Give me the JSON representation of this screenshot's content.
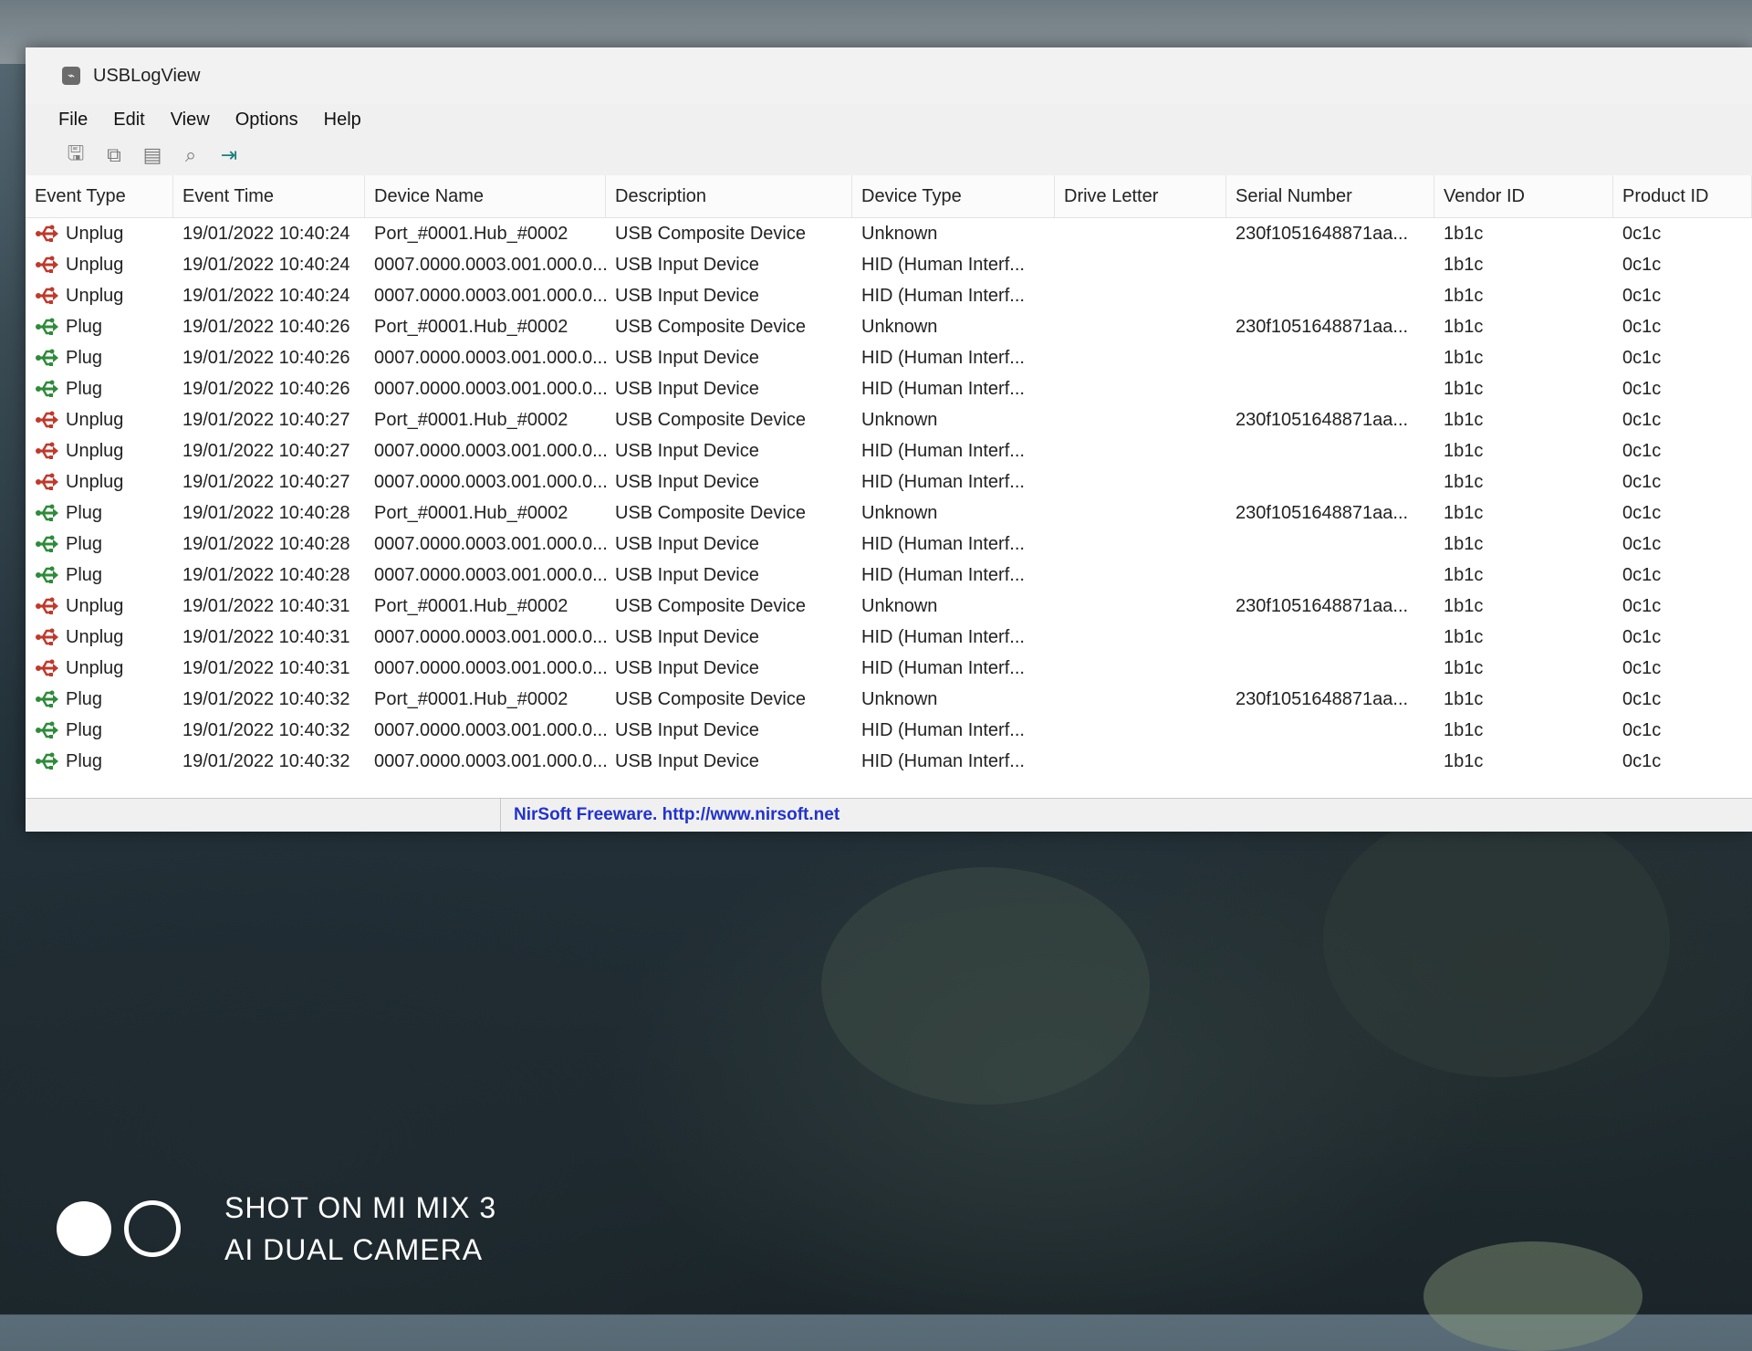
{
  "window": {
    "title": "USBLogView"
  },
  "menu": [
    "File",
    "Edit",
    "View",
    "Options",
    "Help"
  ],
  "columns": [
    "Event Type",
    "Event Time",
    "Device Name",
    "Description",
    "Device Type",
    "Drive Letter",
    "Serial Number",
    "Vendor ID",
    "Product ID"
  ],
  "rows": [
    {
      "event": "Unplug",
      "time": "19/01/2022 10:40:24",
      "device": "Port_#0001.Hub_#0002",
      "description": "USB Composite Device",
      "type": "Unknown",
      "drive": "",
      "serial": "230f1051648871aa...",
      "vendor": "1b1c",
      "product": "0c1c"
    },
    {
      "event": "Unplug",
      "time": "19/01/2022 10:40:24",
      "device": "0007.0000.0003.001.000.0...",
      "description": "USB Input Device",
      "type": "HID (Human Interf...",
      "drive": "",
      "serial": "",
      "vendor": "1b1c",
      "product": "0c1c"
    },
    {
      "event": "Unplug",
      "time": "19/01/2022 10:40:24",
      "device": "0007.0000.0003.001.000.0...",
      "description": "USB Input Device",
      "type": "HID (Human Interf...",
      "drive": "",
      "serial": "",
      "vendor": "1b1c",
      "product": "0c1c"
    },
    {
      "event": "Plug",
      "time": "19/01/2022 10:40:26",
      "device": "Port_#0001.Hub_#0002",
      "description": "USB Composite Device",
      "type": "Unknown",
      "drive": "",
      "serial": "230f1051648871aa...",
      "vendor": "1b1c",
      "product": "0c1c"
    },
    {
      "event": "Plug",
      "time": "19/01/2022 10:40:26",
      "device": "0007.0000.0003.001.000.0...",
      "description": "USB Input Device",
      "type": "HID (Human Interf...",
      "drive": "",
      "serial": "",
      "vendor": "1b1c",
      "product": "0c1c"
    },
    {
      "event": "Plug",
      "time": "19/01/2022 10:40:26",
      "device": "0007.0000.0003.001.000.0...",
      "description": "USB Input Device",
      "type": "HID (Human Interf...",
      "drive": "",
      "serial": "",
      "vendor": "1b1c",
      "product": "0c1c"
    },
    {
      "event": "Unplug",
      "time": "19/01/2022 10:40:27",
      "device": "Port_#0001.Hub_#0002",
      "description": "USB Composite Device",
      "type": "Unknown",
      "drive": "",
      "serial": "230f1051648871aa...",
      "vendor": "1b1c",
      "product": "0c1c"
    },
    {
      "event": "Unplug",
      "time": "19/01/2022 10:40:27",
      "device": "0007.0000.0003.001.000.0...",
      "description": "USB Input Device",
      "type": "HID (Human Interf...",
      "drive": "",
      "serial": "",
      "vendor": "1b1c",
      "product": "0c1c"
    },
    {
      "event": "Unplug",
      "time": "19/01/2022 10:40:27",
      "device": "0007.0000.0003.001.000.0...",
      "description": "USB Input Device",
      "type": "HID (Human Interf...",
      "drive": "",
      "serial": "",
      "vendor": "1b1c",
      "product": "0c1c"
    },
    {
      "event": "Plug",
      "time": "19/01/2022 10:40:28",
      "device": "Port_#0001.Hub_#0002",
      "description": "USB Composite Device",
      "type": "Unknown",
      "drive": "",
      "serial": "230f1051648871aa...",
      "vendor": "1b1c",
      "product": "0c1c"
    },
    {
      "event": "Plug",
      "time": "19/01/2022 10:40:28",
      "device": "0007.0000.0003.001.000.0...",
      "description": "USB Input Device",
      "type": "HID (Human Interf...",
      "drive": "",
      "serial": "",
      "vendor": "1b1c",
      "product": "0c1c"
    },
    {
      "event": "Plug",
      "time": "19/01/2022 10:40:28",
      "device": "0007.0000.0003.001.000.0...",
      "description": "USB Input Device",
      "type": "HID (Human Interf...",
      "drive": "",
      "serial": "",
      "vendor": "1b1c",
      "product": "0c1c"
    },
    {
      "event": "Unplug",
      "time": "19/01/2022 10:40:31",
      "device": "Port_#0001.Hub_#0002",
      "description": "USB Composite Device",
      "type": "Unknown",
      "drive": "",
      "serial": "230f1051648871aa...",
      "vendor": "1b1c",
      "product": "0c1c"
    },
    {
      "event": "Unplug",
      "time": "19/01/2022 10:40:31",
      "device": "0007.0000.0003.001.000.0...",
      "description": "USB Input Device",
      "type": "HID (Human Interf...",
      "drive": "",
      "serial": "",
      "vendor": "1b1c",
      "product": "0c1c"
    },
    {
      "event": "Unplug",
      "time": "19/01/2022 10:40:31",
      "device": "0007.0000.0003.001.000.0...",
      "description": "USB Input Device",
      "type": "HID (Human Interf...",
      "drive": "",
      "serial": "",
      "vendor": "1b1c",
      "product": "0c1c"
    },
    {
      "event": "Plug",
      "time": "19/01/2022 10:40:32",
      "device": "Port_#0001.Hub_#0002",
      "description": "USB Composite Device",
      "type": "Unknown",
      "drive": "",
      "serial": "230f1051648871aa...",
      "vendor": "1b1c",
      "product": "0c1c"
    },
    {
      "event": "Plug",
      "time": "19/01/2022 10:40:32",
      "device": "0007.0000.0003.001.000.0...",
      "description": "USB Input Device",
      "type": "HID (Human Interf...",
      "drive": "",
      "serial": "",
      "vendor": "1b1c",
      "product": "0c1c"
    },
    {
      "event": "Plug",
      "time": "19/01/2022 10:40:32",
      "device": "0007.0000.0003.001.000.0...",
      "description": "USB Input Device",
      "type": "HID (Human Interf...",
      "drive": "",
      "serial": "",
      "vendor": "1b1c",
      "product": "0c1c"
    }
  ],
  "status": {
    "text": "NirSoft Freeware.  http://www.nirsoft.net"
  },
  "watermark": {
    "line1": "SHOT ON MI MIX 3",
    "line2": "AI DUAL CAMERA"
  },
  "icons": {
    "app": "usb-app-icon",
    "toolbar": [
      "save-icon",
      "copy-icon",
      "properties-icon",
      "find-icon",
      "exit-icon"
    ],
    "unplug": "usb-unplug-icon",
    "plug": "usb-plug-icon"
  },
  "colors": {
    "unplug": "#c0392b",
    "plug": "#2e8b3a",
    "link": "#2233cc",
    "accent": "#1b7f7d"
  }
}
